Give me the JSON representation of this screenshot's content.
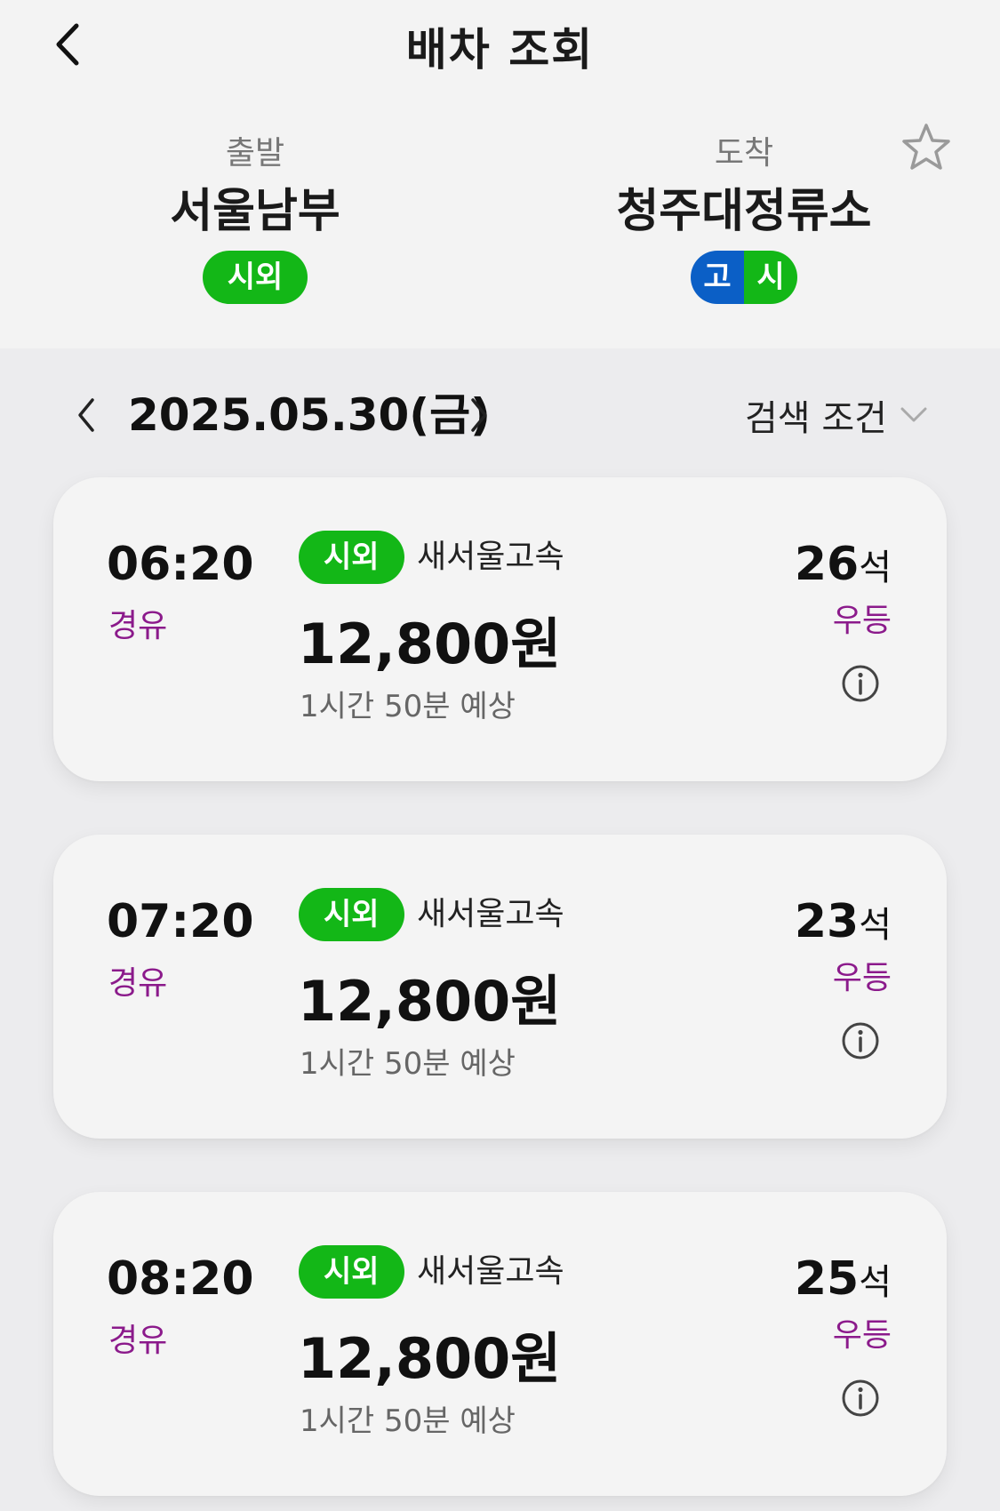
{
  "header": {
    "title": "배차 조회"
  },
  "route": {
    "departure": {
      "label": "출발",
      "name": "서울남부",
      "badge": "시외"
    },
    "arrival": {
      "label": "도착",
      "name": "청주대정류소",
      "badge_left": "고",
      "badge_right": "시"
    }
  },
  "date_bar": {
    "date": "2025.05.30(금)",
    "search_conditions": "검색 조건"
  },
  "schedules": [
    {
      "time": "06:20",
      "via": "경유",
      "type": "시외",
      "company": "새서울고속",
      "price": "12,800원",
      "duration": "1시간 50분 예상",
      "seats": "26",
      "seat_unit": "석",
      "grade": "우등"
    },
    {
      "time": "07:20",
      "via": "경유",
      "type": "시외",
      "company": "새서울고속",
      "price": "12,800원",
      "duration": "1시간 50분 예상",
      "seats": "23",
      "seat_unit": "석",
      "grade": "우등"
    },
    {
      "time": "08:20",
      "via": "경유",
      "type": "시외",
      "company": "새서울고속",
      "price": "12,800원",
      "duration": "1시간 50분 예상",
      "seats": "25",
      "seat_unit": "석",
      "grade": "우등"
    }
  ],
  "colors": {
    "badge_green": "#13b717",
    "badge_blue": "#0b5fc6",
    "accent_purple": "#8b1a8b"
  }
}
